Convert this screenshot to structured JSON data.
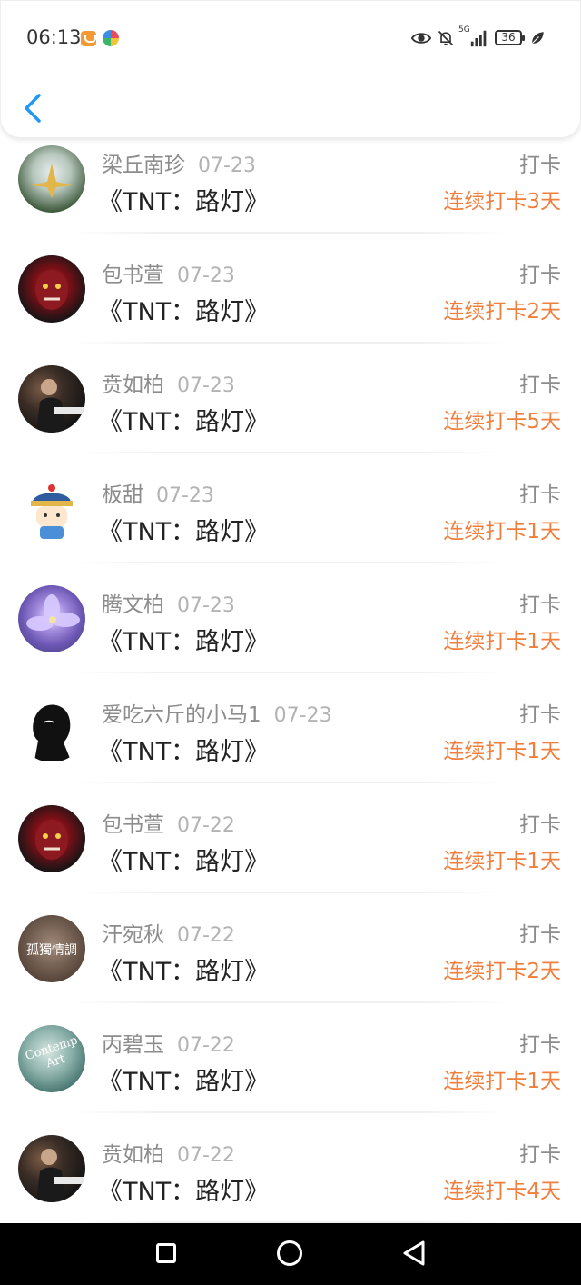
{
  "status_bar": {
    "time": "06:13",
    "network": "5G",
    "battery": "36",
    "icons": [
      "app-icon-orange",
      "app-icon-colorful",
      "eye-icon",
      "mute-bell-icon",
      "signal-icon",
      "battery-icon",
      "leaf-icon"
    ]
  },
  "nav": {
    "back_icon": "chevron-left-icon",
    "accent_color": "#2196f3"
  },
  "colors": {
    "name": "#8c8c8c",
    "date": "#b3b3b3",
    "title": "#222222",
    "streak": "#f07e3c"
  },
  "items": [
    {
      "name": "梁丘南珍",
      "date": "07-23",
      "title": "《TNT：路灯》",
      "action": "打卡",
      "streak": "连续打卡3天",
      "avatar": "crane"
    },
    {
      "name": "包书萱",
      "date": "07-23",
      "title": "《TNT：路灯》",
      "action": "打卡",
      "streak": "连续打卡2天",
      "avatar": "demon"
    },
    {
      "name": "贲如柏",
      "date": "07-23",
      "title": "《TNT：路灯》",
      "action": "打卡",
      "streak": "连续打卡5天",
      "avatar": "piano"
    },
    {
      "name": "板甜",
      "date": "07-23",
      "title": "《TNT：路灯》",
      "action": "打卡",
      "streak": "连续打卡1天",
      "avatar": "cartoon"
    },
    {
      "name": "腾文柏",
      "date": "07-23",
      "title": "《TNT：路灯》",
      "action": "打卡",
      "streak": "连续打卡1天",
      "avatar": "flower"
    },
    {
      "name": "爱吃六斤的小马1",
      "date": "07-23",
      "title": "《TNT：路灯》",
      "action": "打卡",
      "streak": "连续打卡1天",
      "avatar": "silhouette"
    },
    {
      "name": "包书萱",
      "date": "07-22",
      "title": "《TNT：路灯》",
      "action": "打卡",
      "streak": "连续打卡1天",
      "avatar": "demon"
    },
    {
      "name": "汗宛秋",
      "date": "07-22",
      "title": "《TNT：路灯》",
      "action": "打卡",
      "streak": "连续打卡2天",
      "avatar": "sepia",
      "avatar_text": "孤獨情調"
    },
    {
      "name": "丙碧玉",
      "date": "07-22",
      "title": "《TNT：路灯》",
      "action": "打卡",
      "streak": "连续打卡1天",
      "avatar": "teal",
      "avatar_text": "Contemp Art"
    },
    {
      "name": "贲如柏",
      "date": "07-22",
      "title": "《TNT：路灯》",
      "action": "打卡",
      "streak": "连续打卡4天",
      "avatar": "piano"
    }
  ],
  "system_nav": {
    "buttons": [
      "recent-apps-square-icon",
      "home-circle-icon",
      "back-triangle-icon"
    ]
  }
}
